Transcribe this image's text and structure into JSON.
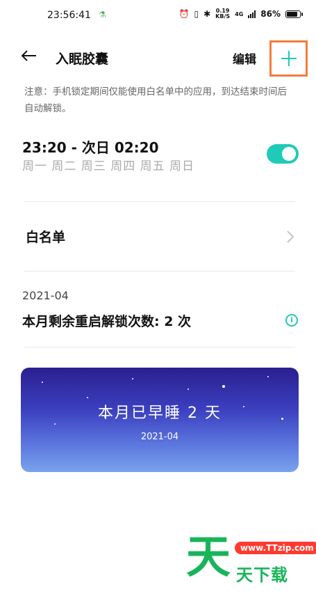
{
  "status_bar": {
    "time": "23:56:41",
    "speed_value": "0.19",
    "speed_unit": "KB/S",
    "network": "4G",
    "battery": "86%",
    "battery_level": 0.86
  },
  "header": {
    "title": "入眠胶囊",
    "edit_label": "编辑"
  },
  "note": "注意：手机锁定期间仅能使用白名单中的应用，到达结束时间后自动解锁。",
  "schedule": {
    "time_range": "23:20 - 次日 02:20",
    "days": "周一 周二 周三 周四 周五 周日",
    "enabled": true
  },
  "whitelist": {
    "label": "白名单"
  },
  "unlock": {
    "month": "2021-04",
    "remaining_text": "本月剩余重启解锁次数: 2 次"
  },
  "sleep_card": {
    "title": "本月已早睡 2 天",
    "month": "2021-04"
  },
  "watermark": {
    "logo_char": "天",
    "url": "www.TTzip.com",
    "name": "天下载"
  },
  "colors": {
    "accent": "#1fcab8",
    "highlight_box": "#f27d3a",
    "watermark_green": "#19b45a"
  }
}
